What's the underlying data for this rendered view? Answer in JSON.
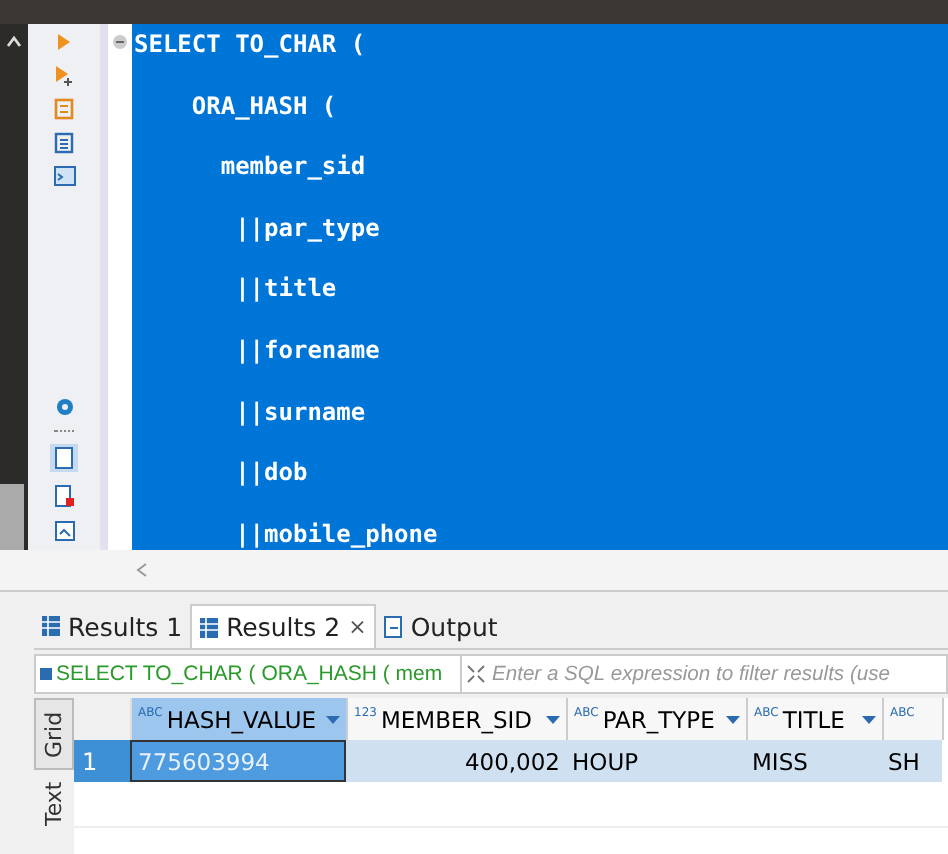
{
  "editor": {
    "lines": [
      "SELECT TO_CHAR (",
      "    ORA_HASH (",
      "      member_sid",
      "       ||par_type",
      "       ||title",
      "       ||forename",
      "       ||surname",
      "       ||dob",
      "       ||mobile_phone"
    ]
  },
  "result_tabs": [
    {
      "label": "Results 1",
      "selected": false,
      "kind": "grid"
    },
    {
      "label": "Results 2",
      "selected": true,
      "close": "×",
      "kind": "grid"
    },
    {
      "label": "Output",
      "selected": false,
      "kind": "output"
    }
  ],
  "filter": {
    "query": "SELECT TO_CHAR ( ORA_HASH ( mem",
    "placeholder": "Enter a SQL expression to filter results (use"
  },
  "view_tabs": [
    {
      "label": "Grid",
      "selected": true
    },
    {
      "label": "Text",
      "selected": false
    }
  ],
  "table": {
    "columns": [
      {
        "label": "HASH_VALUE",
        "type": "ABC",
        "selected": true
      },
      {
        "label": "MEMBER_SID",
        "type": "123",
        "selected": false
      },
      {
        "label": "PAR_TYPE",
        "type": "ABC",
        "selected": false
      },
      {
        "label": "TITLE",
        "type": "ABC",
        "selected": false
      },
      {
        "type": "ABC",
        "selected": false
      }
    ],
    "rows": [
      {
        "number": "1",
        "selected": true,
        "cells": [
          "775603994",
          "400,002",
          "HOUP",
          "MISS",
          "SH"
        ]
      }
    ]
  }
}
